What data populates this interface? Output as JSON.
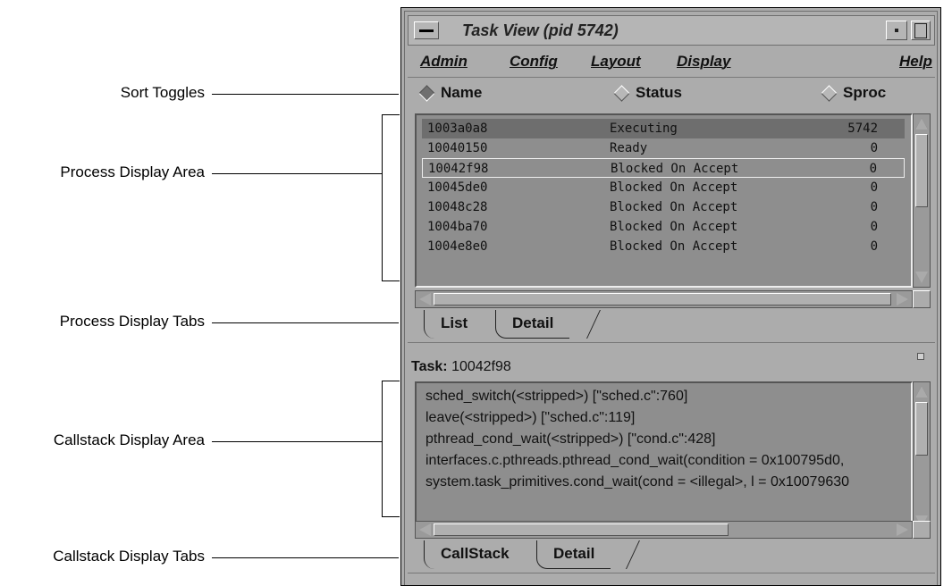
{
  "annotations": {
    "sort_toggles": "Sort Toggles",
    "process_display_area": "Process Display Area",
    "process_display_tabs": "Process Display Tabs",
    "callstack_display_area": "Callstack Display Area",
    "callstack_display_tabs": "Callstack Display Tabs"
  },
  "window": {
    "title": "Task View (pid 5742)"
  },
  "menubar": {
    "admin": "Admin",
    "config": "Config",
    "layout": "Layout",
    "display": "Display",
    "help": "Help"
  },
  "sort": {
    "name": "Name",
    "status": "Status",
    "sproc": "Sproc",
    "selected": "Name"
  },
  "processes": [
    {
      "id": "1003a0a8",
      "status": "Executing",
      "sproc": "5742"
    },
    {
      "id": "10040150",
      "status": "Ready",
      "sproc": "0"
    },
    {
      "id": "10042f98",
      "status": "Blocked On Accept",
      "sproc": "0"
    },
    {
      "id": "10045de0",
      "status": "Blocked On Accept",
      "sproc": "0"
    },
    {
      "id": "10048c28",
      "status": "Blocked On Accept",
      "sproc": "0"
    },
    {
      "id": "1004ba70",
      "status": "Blocked On Accept",
      "sproc": "0"
    },
    {
      "id": "1004e8e0",
      "status": "Blocked On Accept",
      "sproc": "0"
    }
  ],
  "process_tabs": {
    "list": "List",
    "detail": "Detail"
  },
  "task": {
    "label": "Task:",
    "value": "10042f98"
  },
  "callstack": [
    "sched_switch(<stripped>) [\"sched.c\":760]",
    "leave(<stripped>) [\"sched.c\":119]",
    "pthread_cond_wait(<stripped>) [\"cond.c\":428]",
    "interfaces.c.pthreads.pthread_cond_wait(condition = 0x100795d0,",
    "system.task_primitives.cond_wait(cond = <illegal>, l = 0x10079630"
  ],
  "callstack_tabs": {
    "callstack": "CallStack",
    "detail": "Detail"
  }
}
